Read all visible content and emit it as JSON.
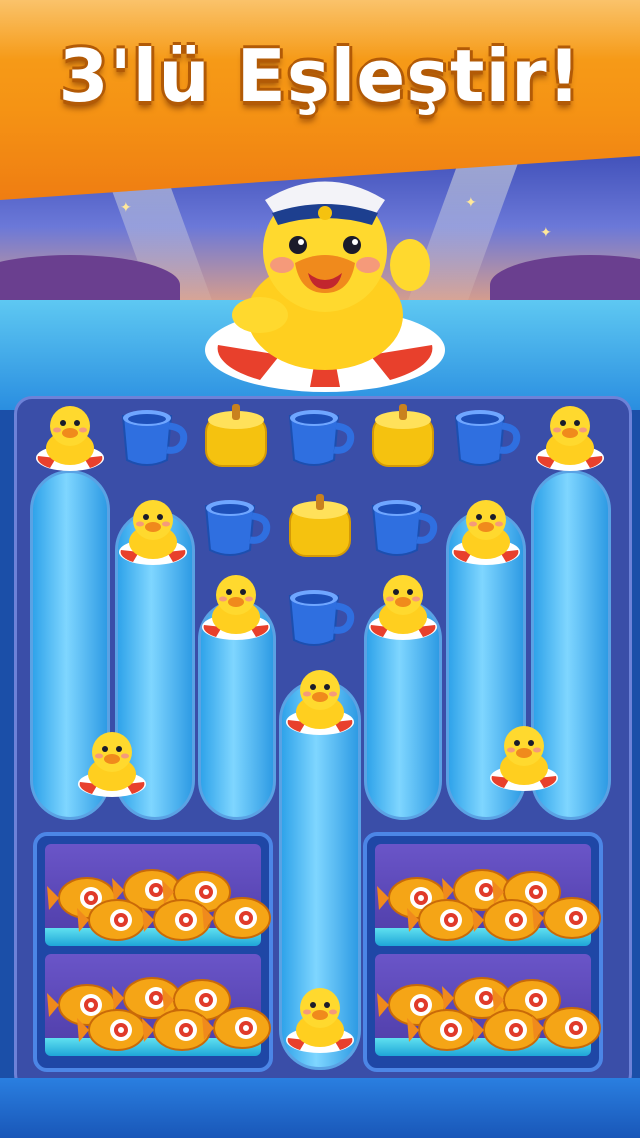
{
  "banner": {
    "title": "3'lü Eşleştir!"
  },
  "board": {
    "top_row": [
      "duck-tile",
      "cup-tile",
      "honey-tile",
      "cup-tile",
      "honey-tile",
      "cup-tile",
      "duck-tile"
    ],
    "second_row": [
      "duck-tile",
      "cup-tile",
      "honey-tile",
      "cup-tile",
      "duck-tile"
    ],
    "third_row": [
      "duck-tile",
      "cup-tile",
      "duck-tile"
    ],
    "fish_trays": 2
  },
  "colors": {
    "banner": "#f59314",
    "water": "#2fa3ea",
    "board": "#3a4ea8",
    "duck": "#ffd21f",
    "cup": "#2f6fe0",
    "honey": "#f5c20f"
  }
}
